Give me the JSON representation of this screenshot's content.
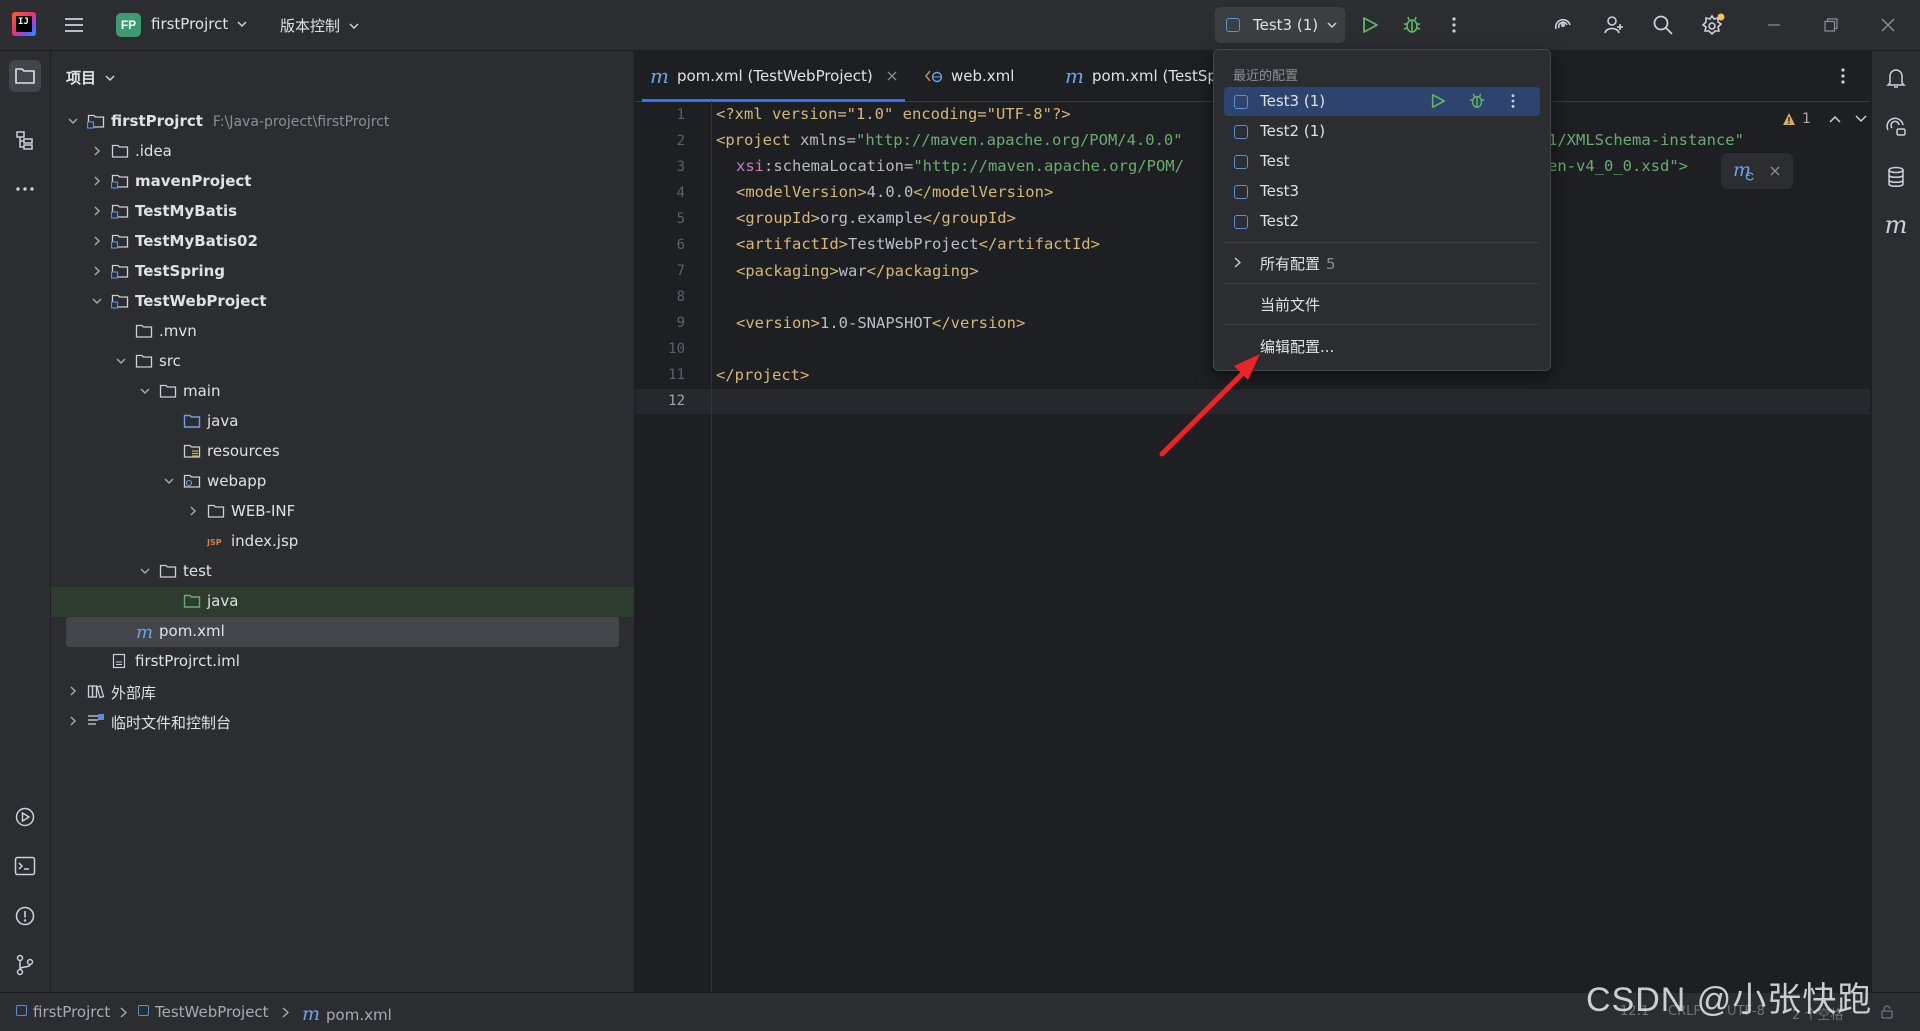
{
  "titlebar": {
    "app_logo_text": "IJ",
    "project_badge": "FP",
    "project_name": "firstProjrct",
    "vcs_label": "版本控制",
    "run_config": "Test3 (1)"
  },
  "project_panel": {
    "title": "项目",
    "tree": [
      {
        "label": "firstProjrct",
        "path": "F:\\Java-project\\firstProjrct"
      },
      {
        "label": ".idea"
      },
      {
        "label": "mavenProject"
      },
      {
        "label": "TestMyBatis"
      },
      {
        "label": "TestMyBatis02"
      },
      {
        "label": "TestSpring"
      },
      {
        "label": "TestWebProject"
      },
      {
        "label": ".mvn"
      },
      {
        "label": "src"
      },
      {
        "label": "main"
      },
      {
        "label": "java"
      },
      {
        "label": "resources"
      },
      {
        "label": "webapp"
      },
      {
        "label": "WEB-INF"
      },
      {
        "label": "index.jsp"
      },
      {
        "label": "test"
      },
      {
        "label": "java"
      },
      {
        "label": "pom.xml"
      },
      {
        "label": "firstProjrct.iml"
      },
      {
        "label": "外部库"
      },
      {
        "label": "临时文件和控制台"
      }
    ]
  },
  "editor": {
    "tabs": [
      {
        "label": "pom.xml (TestWebProject)"
      },
      {
        "label": "web.xml"
      },
      {
        "label": "pom.xml (TestSp"
      }
    ],
    "line_numbers": [
      "1",
      "2",
      "3",
      "4",
      "5",
      "6",
      "7",
      "8",
      "9",
      "10",
      "11",
      "12"
    ],
    "code": {
      "l1": "<?xml version=\"1.0\" encoding=\"UTF-8\"?>",
      "l2a": "<project",
      "l2b": " xmlns=",
      "l2c": "\"http://maven.apache.org/POM/4.0.0\"",
      "l2d": "1/XMLSchema-instance\"",
      "l3a": "xsi",
      "l3b": ":schemaLocation=",
      "l3c": "\"http://maven.apache.org/POM/",
      "l3d": "en-v4_0_0.xsd\">",
      "l4a": "<modelVersion>",
      "l4b": "4.0.0",
      "l4c": "</modelVersion>",
      "l5a": "<groupId>",
      "l5b": "org.example",
      "l5c": "</groupId>",
      "l6a": "<artifactId>",
      "l6b": "TestWebProject",
      "l6c": "</artifactId>",
      "l7a": "<packaging>",
      "l7b": "war",
      "l7c": "</packaging>",
      "l9a": "<version>",
      "l9b": "1.0-SNAPSHOT",
      "l9c": "</version>",
      "l11": "</project>"
    },
    "warning_count": "1"
  },
  "popup": {
    "header": "最近的配置",
    "items": [
      {
        "label": "Test3 (1)"
      },
      {
        "label": "Test2 (1)"
      },
      {
        "label": "Test"
      },
      {
        "label": "Test3"
      },
      {
        "label": "Test2"
      }
    ],
    "all_configs": "所有配置",
    "all_configs_count": "5",
    "current_file": "当前文件",
    "edit_configs": "编辑配置..."
  },
  "statusbar": {
    "breadcrumb": [
      "firstProjrct",
      "TestWebProject",
      "pom.xml"
    ],
    "position": "12:1",
    "line_sep": "CRLF",
    "encoding": "UTF-8",
    "indent": "2 个空格"
  },
  "watermark": "CSDN @小张快跑",
  "colors": {
    "accent": "#3574f0",
    "run_green": "#5fb865",
    "arrow_red": "#e8262a",
    "selection": "#2e436e"
  }
}
